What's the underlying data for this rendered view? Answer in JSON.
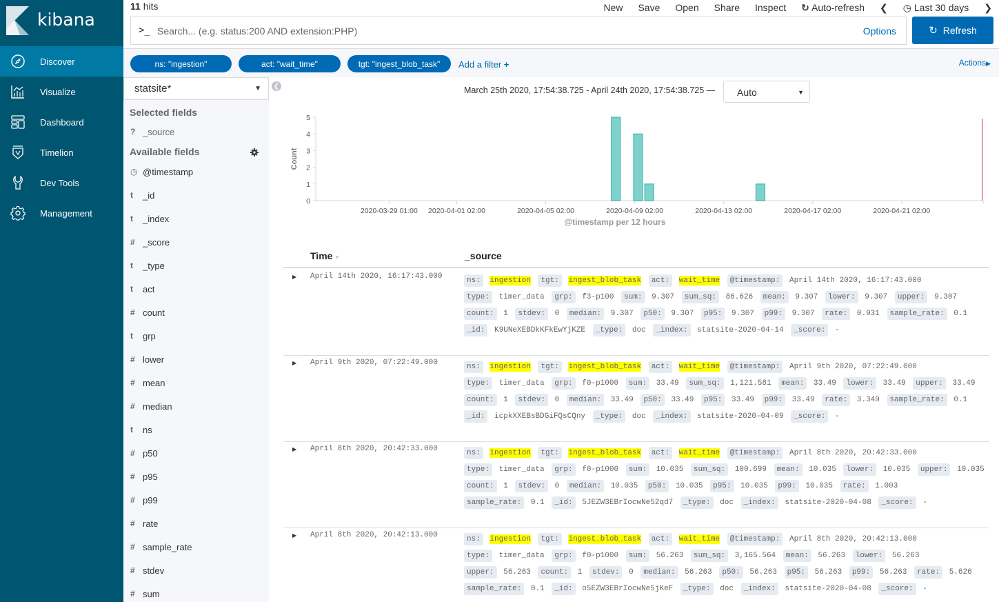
{
  "sidebar": {
    "brand": "kibana",
    "items": [
      {
        "label": "Discover",
        "icon": "compass-icon",
        "active": true
      },
      {
        "label": "Visualize",
        "icon": "chart-icon",
        "active": false
      },
      {
        "label": "Dashboard",
        "icon": "dashboard-icon",
        "active": false
      },
      {
        "label": "Timelion",
        "icon": "timelion-icon",
        "active": false
      },
      {
        "label": "Dev Tools",
        "icon": "wrench-icon",
        "active": false
      },
      {
        "label": "Management",
        "icon": "gear-icon",
        "active": false
      }
    ]
  },
  "header": {
    "hits_count": "11",
    "hits_label": " hits",
    "menu": {
      "new": "New",
      "save": "Save",
      "open": "Open",
      "share": "Share",
      "inspect": "Inspect",
      "auto_refresh": "Auto-refresh",
      "time_range": "Last 30 days"
    },
    "search": {
      "prompt": ">_",
      "placeholder": "Search... (e.g. status:200 AND extension:PHP)",
      "value": ""
    },
    "options_label": "Options",
    "refresh_label": "Refresh"
  },
  "filters": {
    "pills": [
      "ns: \"ingestion\"",
      "act: \"wait_time\"",
      "tgt: \"ingest_blob_task\""
    ],
    "add_filter_label": "Add a filter",
    "actions_label": "Actions"
  },
  "fieldpanel": {
    "index_pattern": "statsite*",
    "selected_title": "Selected fields",
    "selected": [
      {
        "type": "?",
        "name": "_source"
      }
    ],
    "available_title": "Available fields",
    "available": [
      {
        "type": "clock",
        "name": "@timestamp"
      },
      {
        "type": "t",
        "name": "_id"
      },
      {
        "type": "t",
        "name": "_index"
      },
      {
        "type": "#",
        "name": "_score"
      },
      {
        "type": "t",
        "name": "_type"
      },
      {
        "type": "t",
        "name": "act"
      },
      {
        "type": "#",
        "name": "count"
      },
      {
        "type": "t",
        "name": "grp"
      },
      {
        "type": "#",
        "name": "lower"
      },
      {
        "type": "#",
        "name": "mean"
      },
      {
        "type": "#",
        "name": "median"
      },
      {
        "type": "t",
        "name": "ns"
      },
      {
        "type": "#",
        "name": "p50"
      },
      {
        "type": "#",
        "name": "p95"
      },
      {
        "type": "#",
        "name": "p99"
      },
      {
        "type": "#",
        "name": "rate"
      },
      {
        "type": "#",
        "name": "sample_rate"
      },
      {
        "type": "#",
        "name": "stdev"
      },
      {
        "type": "#",
        "name": "sum"
      }
    ]
  },
  "main": {
    "time_range_text": "March 25th 2020, 17:54:38.725 - April 24th 2020, 17:54:38.725 —",
    "interval": "Auto",
    "table": {
      "col_time": "Time",
      "col_source": "_source"
    }
  },
  "chart_data": {
    "type": "bar",
    "title": "",
    "xlabel": "@timestamp per 12 hours",
    "ylabel": "Count",
    "ylim": [
      0,
      5
    ],
    "yticks": [
      0,
      1,
      2,
      3,
      4,
      5
    ],
    "x_range": [
      "2020-03-25 17:54",
      "2020-04-24 17:54"
    ],
    "xtick_labels": [
      "2020-03-29 01:00",
      "2020-04-01 02:00",
      "2020-04-05 02:00",
      "2020-04-09 02:00",
      "2020-04-13 02:00",
      "2020-04-17 02:00",
      "2020-04-21 02:00"
    ],
    "bar_color": "#7fd1cc",
    "bar_stroke": "#2fb3a7",
    "now_marker_color": "#e7a3a8",
    "bars": [
      {
        "bucket": "2020-04-08 00:00",
        "value": 5
      },
      {
        "bucket": "2020-04-08 12:00",
        "value": 0
      },
      {
        "bucket": "2020-04-09 00:00",
        "value": 4
      },
      {
        "bucket": "2020-04-09 12:00",
        "value": 1
      },
      {
        "bucket": "2020-04-14 12:00",
        "value": 1
      }
    ]
  },
  "documents": [
    {
      "time": "April 14th 2020, 16:17:43.000",
      "fields": [
        {
          "k": "ns:",
          "v": "ingestion",
          "hl": true
        },
        {
          "k": "tgt:",
          "v": "ingest_blob_task",
          "hl": true
        },
        {
          "k": "act:",
          "v": "wait_time",
          "hl": true
        },
        {
          "k": "@timestamp:",
          "v": "April 14th 2020, 16:17:43.000"
        },
        {
          "k": "type:",
          "v": "timer_data"
        },
        {
          "k": "grp:",
          "v": "f3-p100"
        },
        {
          "k": "sum:",
          "v": "9.307"
        },
        {
          "k": "sum_sq:",
          "v": "86.626"
        },
        {
          "k": "mean:",
          "v": "9.307"
        },
        {
          "k": "lower:",
          "v": "9.307"
        },
        {
          "k": "upper:",
          "v": "9.307"
        },
        {
          "k": "count:",
          "v": "1"
        },
        {
          "k": "stdev:",
          "v": "0"
        },
        {
          "k": "median:",
          "v": "9.307"
        },
        {
          "k": "p50:",
          "v": "9.307"
        },
        {
          "k": "p95:",
          "v": "9.307"
        },
        {
          "k": "p99:",
          "v": "9.307"
        },
        {
          "k": "rate:",
          "v": "0.931"
        },
        {
          "k": "sample_rate:",
          "v": "0.1"
        },
        {
          "k": "_id:",
          "v": "K9UNeXEBDkKFkEwYjKZE"
        },
        {
          "k": "_type:",
          "v": "doc"
        },
        {
          "k": "_index:",
          "v": "statsite-2020-04-14"
        },
        {
          "k": "_score:",
          "v": " -"
        }
      ]
    },
    {
      "time": "April 9th 2020, 07:22:49.000",
      "fields": [
        {
          "k": "ns:",
          "v": "ingestion",
          "hl": true
        },
        {
          "k": "tgt:",
          "v": "ingest_blob_task",
          "hl": true
        },
        {
          "k": "act:",
          "v": "wait_time",
          "hl": true
        },
        {
          "k": "@timestamp:",
          "v": "April 9th 2020, 07:22:49.000"
        },
        {
          "k": "type:",
          "v": "timer_data"
        },
        {
          "k": "grp:",
          "v": "f0-p1000"
        },
        {
          "k": "sum:",
          "v": "33.49"
        },
        {
          "k": "sum_sq:",
          "v": "1,121.581"
        },
        {
          "k": "mean:",
          "v": "33.49"
        },
        {
          "k": "lower:",
          "v": "33.49"
        },
        {
          "k": "upper:",
          "v": "33.49"
        },
        {
          "k": "count:",
          "v": "1"
        },
        {
          "k": "stdev:",
          "v": "0"
        },
        {
          "k": "median:",
          "v": "33.49"
        },
        {
          "k": "p50:",
          "v": "33.49"
        },
        {
          "k": "p95:",
          "v": "33.49"
        },
        {
          "k": "p99:",
          "v": "33.49"
        },
        {
          "k": "rate:",
          "v": "3.349"
        },
        {
          "k": "sample_rate:",
          "v": "0.1"
        },
        {
          "k": "_id:",
          "v": "icpkXXEBsBDGiFQsCQny"
        },
        {
          "k": "_type:",
          "v": "doc"
        },
        {
          "k": "_index:",
          "v": "statsite-2020-04-09"
        },
        {
          "k": "_score:",
          "v": " -"
        }
      ]
    },
    {
      "time": "April 8th 2020, 20:42:33.000",
      "fields": [
        {
          "k": "ns:",
          "v": "ingestion",
          "hl": true
        },
        {
          "k": "tgt:",
          "v": "ingest_blob_task",
          "hl": true
        },
        {
          "k": "act:",
          "v": "wait_time",
          "hl": true
        },
        {
          "k": "@timestamp:",
          "v": "April 8th 2020, 20:42:33.000"
        },
        {
          "k": "type:",
          "v": "timer_data"
        },
        {
          "k": "grp:",
          "v": "f0-p1000"
        },
        {
          "k": "sum:",
          "v": "10.035"
        },
        {
          "k": "sum_sq:",
          "v": "100.699"
        },
        {
          "k": "mean:",
          "v": "10.035"
        },
        {
          "k": "lower:",
          "v": "10.035"
        },
        {
          "k": "upper:",
          "v": "10.035"
        },
        {
          "k": "count:",
          "v": "1"
        },
        {
          "k": "stdev:",
          "v": "0"
        },
        {
          "k": "median:",
          "v": "10.035"
        },
        {
          "k": "p50:",
          "v": "10.035"
        },
        {
          "k": "p95:",
          "v": "10.035"
        },
        {
          "k": "p99:",
          "v": "10.035"
        },
        {
          "k": "rate:",
          "v": "1.003"
        },
        {
          "k": "sample_rate:",
          "v": "0.1"
        },
        {
          "k": "_id:",
          "v": "5JEZW3EBrIocwNe52qd7"
        },
        {
          "k": "_type:",
          "v": "doc"
        },
        {
          "k": "_index:",
          "v": "statsite-2020-04-08"
        },
        {
          "k": "_score:",
          "v": " -"
        }
      ]
    },
    {
      "time": "April 8th 2020, 20:42:13.000",
      "fields": [
        {
          "k": "ns:",
          "v": "ingestion",
          "hl": true
        },
        {
          "k": "tgt:",
          "v": "ingest_blob_task",
          "hl": true
        },
        {
          "k": "act:",
          "v": "wait_time",
          "hl": true
        },
        {
          "k": "@timestamp:",
          "v": "April 8th 2020, 20:42:13.000"
        },
        {
          "k": "type:",
          "v": "timer_data"
        },
        {
          "k": "grp:",
          "v": "f0-p1000"
        },
        {
          "k": "sum:",
          "v": "56.263"
        },
        {
          "k": "sum_sq:",
          "v": "3,165.564"
        },
        {
          "k": "mean:",
          "v": "56.263"
        },
        {
          "k": "lower:",
          "v": "56.263"
        },
        {
          "k": "upper:",
          "v": "56.263"
        },
        {
          "k": "count:",
          "v": "1"
        },
        {
          "k": "stdev:",
          "v": "0"
        },
        {
          "k": "median:",
          "v": "56.263"
        },
        {
          "k": "p50:",
          "v": "56.263"
        },
        {
          "k": "p95:",
          "v": "56.263"
        },
        {
          "k": "p99:",
          "v": "56.263"
        },
        {
          "k": "rate:",
          "v": "5.626"
        },
        {
          "k": "sample_rate:",
          "v": "0.1"
        },
        {
          "k": "_id:",
          "v": "o5EZW3EBrIocwNe5jKeF"
        },
        {
          "k": "_type:",
          "v": "doc"
        },
        {
          "k": "_index:",
          "v": "statsite-2020-04-08"
        },
        {
          "k": "_score:",
          "v": " -"
        }
      ]
    }
  ]
}
